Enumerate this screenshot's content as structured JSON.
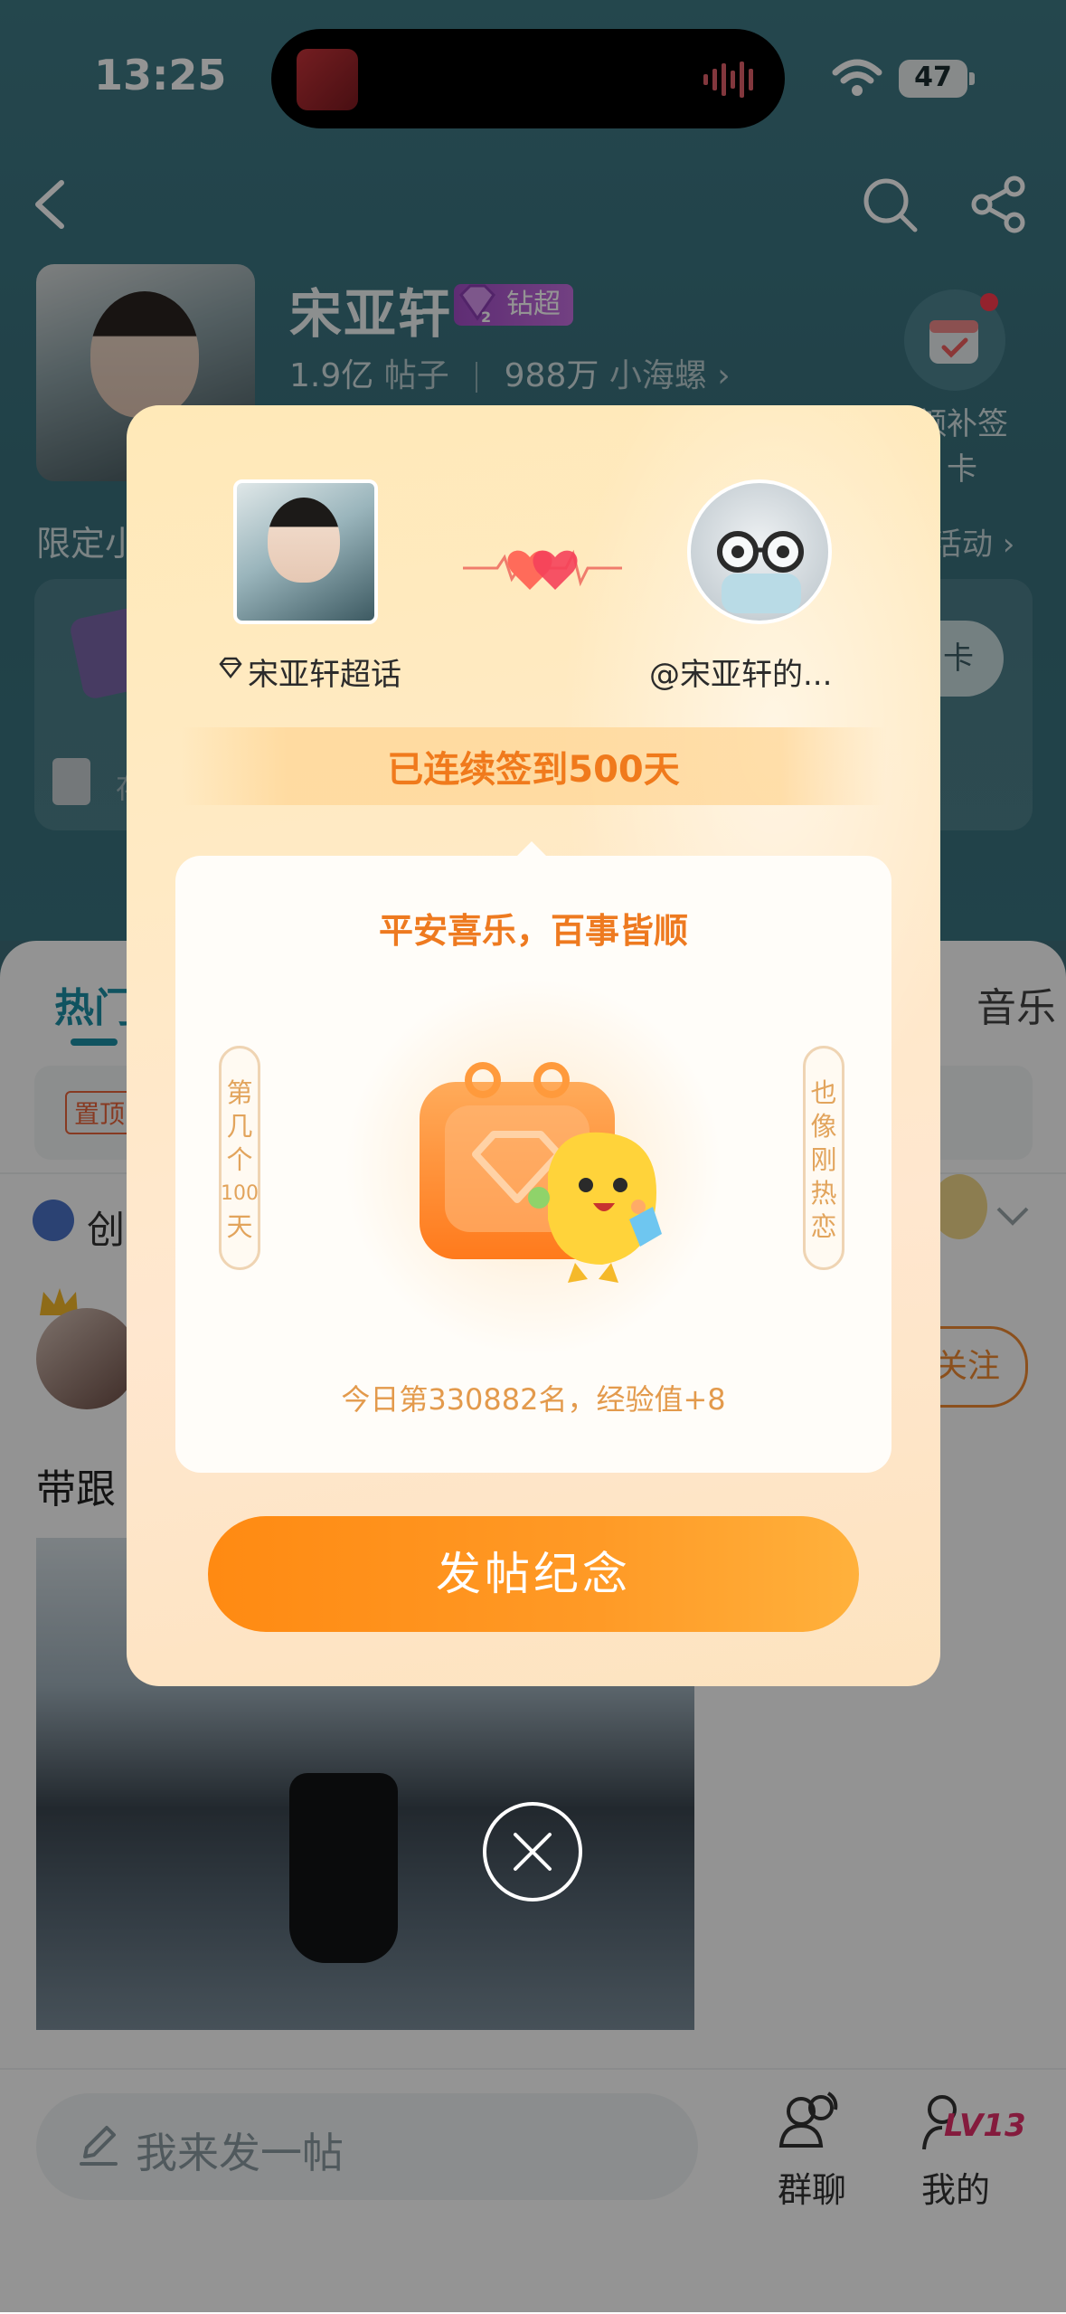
{
  "status_bar": {
    "time": "13:25",
    "battery": "47"
  },
  "header": {
    "topic_name": "宋亚轩",
    "super_badge": "钻超",
    "posts_count": "1.9亿",
    "posts_label": "帖子",
    "members_count": "988万",
    "members_label": "小海螺",
    "checkin_label_line1": "额补签",
    "checkin_label_line2": "卡"
  },
  "background": {
    "limited_label": "限定小",
    "activity_link": "活动 ›",
    "card_button": "卡",
    "card_mini_text": "存",
    "tabs": {
      "hot": "热门",
      "music": "音乐"
    },
    "pinned_tag": "置顶",
    "creator_row": "创",
    "follow": "关注",
    "post_title": "带跟",
    "compose_placeholder": "我来发一帖",
    "nav": {
      "group": "群聊",
      "me": "我的",
      "level": "LV13"
    }
  },
  "modal": {
    "topic_caption": "宋亚轩超话",
    "user_caption": "@宋亚轩的...",
    "streak_text": "已连续签到500天",
    "blessing": "平安喜乐，百事皆顺",
    "scroll_left_lines": [
      "第",
      "几",
      "个",
      "100",
      "天"
    ],
    "scroll_right_lines": [
      "也",
      "像",
      "刚",
      "热",
      "恋"
    ],
    "rank_text": "今日第330882名，经验值+8",
    "post_button": "发帖纪念"
  },
  "colors": {
    "accent_orange": "#ff8a12",
    "teal": "#1c8fa5",
    "super_purple": "#a34ec8"
  }
}
